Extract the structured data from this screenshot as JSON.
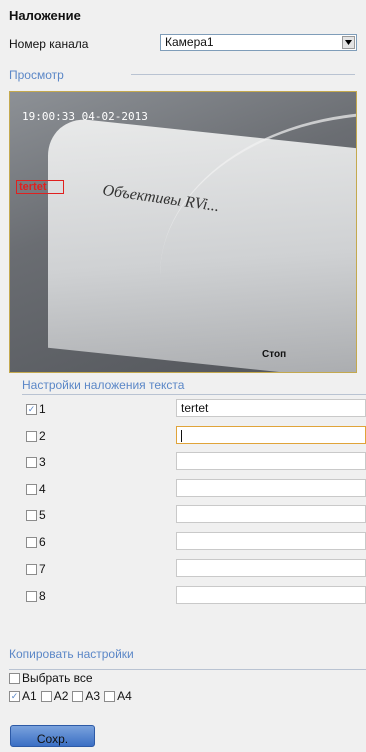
{
  "header": {
    "title": "Наложение"
  },
  "channel": {
    "label": "Номер канала",
    "value": "Камера1"
  },
  "preview": {
    "label": "Просмотр",
    "timestamp": "19:00:33 04-02-2013",
    "overlay_text": "tertet",
    "page_title": "Объективы RVi...",
    "stop_label": "Стоп"
  },
  "text_overlay": {
    "label": "Настройки наложения текста",
    "rows": [
      {
        "num": "1",
        "checked": true,
        "value": "tertet"
      },
      {
        "num": "2",
        "checked": false,
        "value": ""
      },
      {
        "num": "3",
        "checked": false,
        "value": ""
      },
      {
        "num": "4",
        "checked": false,
        "value": ""
      },
      {
        "num": "5",
        "checked": false,
        "value": ""
      },
      {
        "num": "6",
        "checked": false,
        "value": ""
      },
      {
        "num": "7",
        "checked": false,
        "value": ""
      },
      {
        "num": "8",
        "checked": false,
        "value": ""
      }
    ]
  },
  "copy": {
    "label": "Копировать настройки",
    "select_all": "Выбрать все",
    "channels": [
      {
        "label": "A1",
        "checked": true
      },
      {
        "label": "A2",
        "checked": false
      },
      {
        "label": "A3",
        "checked": false
      },
      {
        "label": "A4",
        "checked": false
      }
    ]
  },
  "save_label": "Сохр."
}
